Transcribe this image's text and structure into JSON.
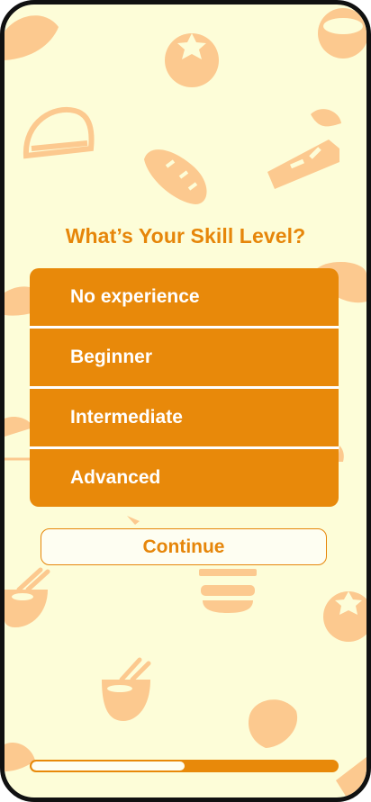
{
  "screen": {
    "title": "What’s Your Skill Level?",
    "options": [
      {
        "label": "No experience"
      },
      {
        "label": "Beginner"
      },
      {
        "label": "Intermediate"
      },
      {
        "label": "Advanced"
      }
    ],
    "continue_label": "Continue"
  },
  "progress": {
    "fraction_unfilled": 0.5,
    "fraction_filled": 0.5
  },
  "colors": {
    "accent": "#e8890a",
    "background": "#fdfdd8",
    "doodle": "#fcc98f"
  },
  "background_icons": [
    "croissant-icon",
    "tomato-icon",
    "coconut-icon",
    "taco-icon",
    "bread-icon",
    "cheese-icon",
    "burger-icon",
    "bowl-chopsticks-icon"
  ]
}
